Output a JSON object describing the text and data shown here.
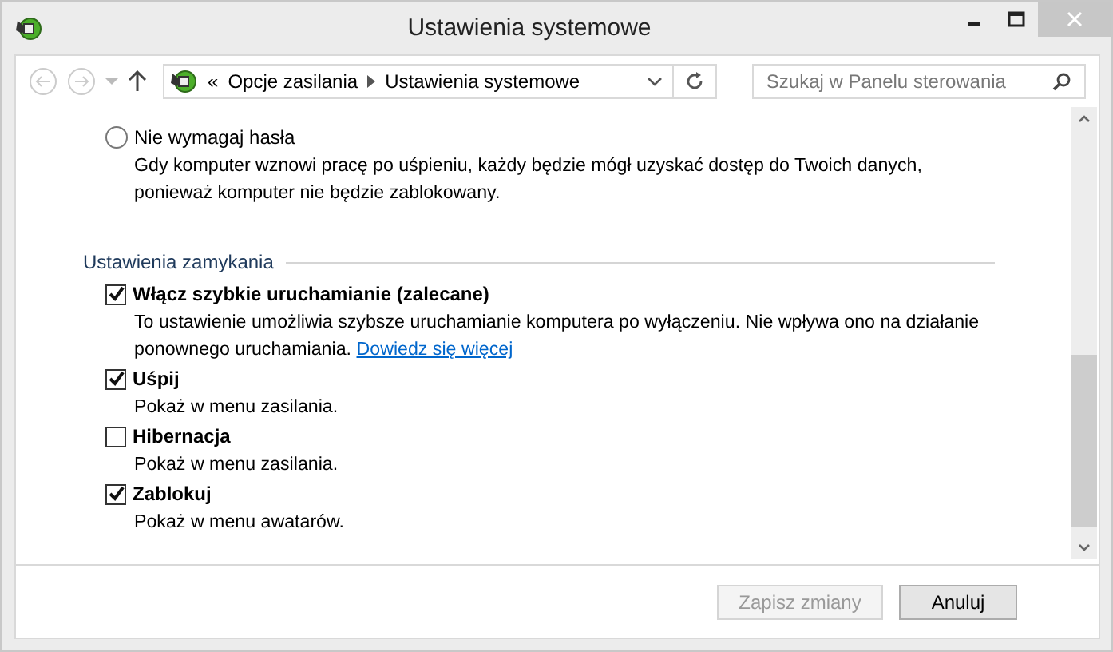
{
  "window": {
    "title": "Ustawienia systemowe"
  },
  "navigation": {
    "breadcrumb_prefix": "«",
    "breadcrumbs": [
      "Opcje zasilania",
      "Ustawienia systemowe"
    ],
    "search": {
      "placeholder": "Szukaj w Panelu sterowania"
    }
  },
  "password_option": {
    "label": "Nie wymagaj hasła",
    "selected": false,
    "description": "Gdy komputer wznowi pracę po uśpieniu, każdy będzie mógł uzyskać dostęp do Twoich danych, ponieważ komputer nie będzie zablokowany."
  },
  "shutdown_settings": {
    "title": "Ustawienia zamykania",
    "options": [
      {
        "label": "Włącz szybkie uruchamianie (zalecane)",
        "checked": true,
        "description": "To ustawienie umożliwia szybsze uruchamianie komputera po wyłączeniu. Nie wpływa ono na działanie ponownego uruchamiania.",
        "link": "Dowiedz się więcej"
      },
      {
        "label": "Uśpij",
        "checked": true,
        "description": "Pokaż w menu zasilania."
      },
      {
        "label": "Hibernacja",
        "checked": false,
        "description": "Pokaż w menu zasilania."
      },
      {
        "label": "Zablokuj",
        "checked": true,
        "description": "Pokaż w menu awatarów."
      }
    ]
  },
  "buttons": [
    {
      "label": "Zapisz zmiany",
      "disabled": true
    },
    {
      "label": "Anuluj",
      "disabled": false
    }
  ]
}
